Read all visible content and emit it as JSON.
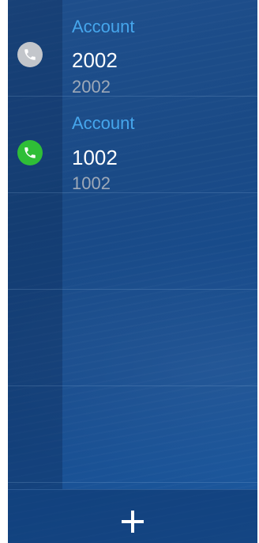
{
  "lines": [
    {
      "account_label": "Account",
      "number": "2002",
      "sub_number": "2002",
      "status": "idle",
      "status_color": "#c3c6cb",
      "icon": "phone-icon"
    },
    {
      "account_label": "Account",
      "number": "1002",
      "sub_number": "1002",
      "status": "registered",
      "status_color": "#2fbe37",
      "icon": "phone-icon"
    }
  ],
  "empty_slots": 3,
  "bottom_bar": {
    "add_icon": "plus-icon"
  },
  "colors": {
    "background": "#1a4a86",
    "account_label": "#46a6ec",
    "number": "#ffffff",
    "sub_number": "#9ea9b8"
  }
}
